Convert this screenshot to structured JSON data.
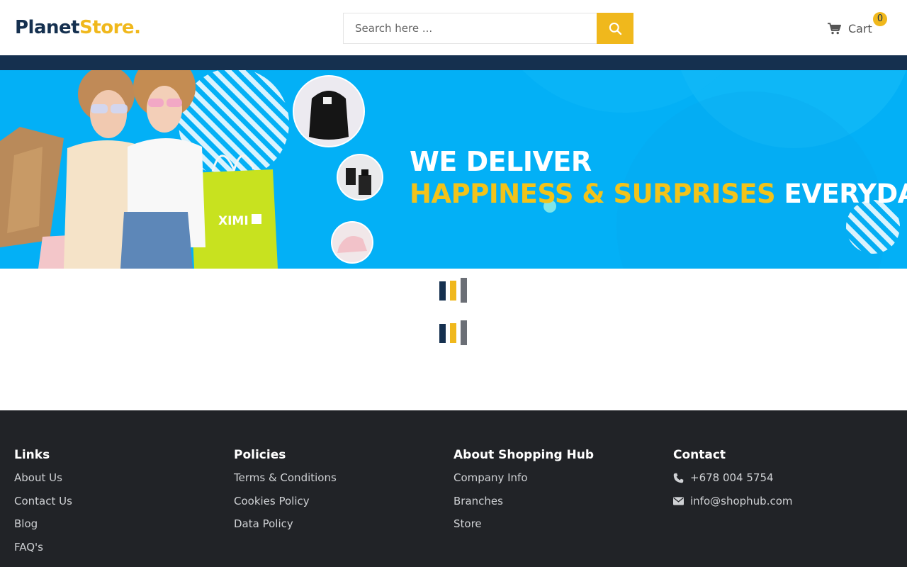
{
  "header": {
    "logo_part1": "Planet",
    "logo_part2": "Store.",
    "search_placeholder": "Search here ...",
    "search_icon": "search-icon",
    "cart_label": "Cart",
    "cart_count": "0",
    "cart_icon": "cart-icon"
  },
  "banner": {
    "line1": "WE DELIVER",
    "line2_highlight": "HAPPINESS & SURPRISES",
    "line2_rest": "EVERYDAY",
    "bag_brand": "XIMI",
    "colors": {
      "background": "#03b0f6",
      "accent": "#f2c31a"
    }
  },
  "footer": {
    "columns": [
      {
        "title": "Links",
        "items": [
          "About Us",
          "Contact Us",
          "Blog",
          "FAQ's"
        ]
      },
      {
        "title": "Policies",
        "items": [
          "Terms & Conditions",
          "Cookies Policy",
          "Data Policy"
        ]
      },
      {
        "title": "About Shopping Hub",
        "items": [
          "Company Info",
          "Branches",
          "Store"
        ]
      },
      {
        "title": "Contact",
        "items": [
          {
            "icon": "phone-icon",
            "text": "+678 004 5754"
          },
          {
            "icon": "envelope-icon",
            "text": "info@shophub.com"
          }
        ]
      }
    ]
  },
  "colors": {
    "navy": "#15304f",
    "yellow": "#f0b81c",
    "footer": "#212327"
  }
}
